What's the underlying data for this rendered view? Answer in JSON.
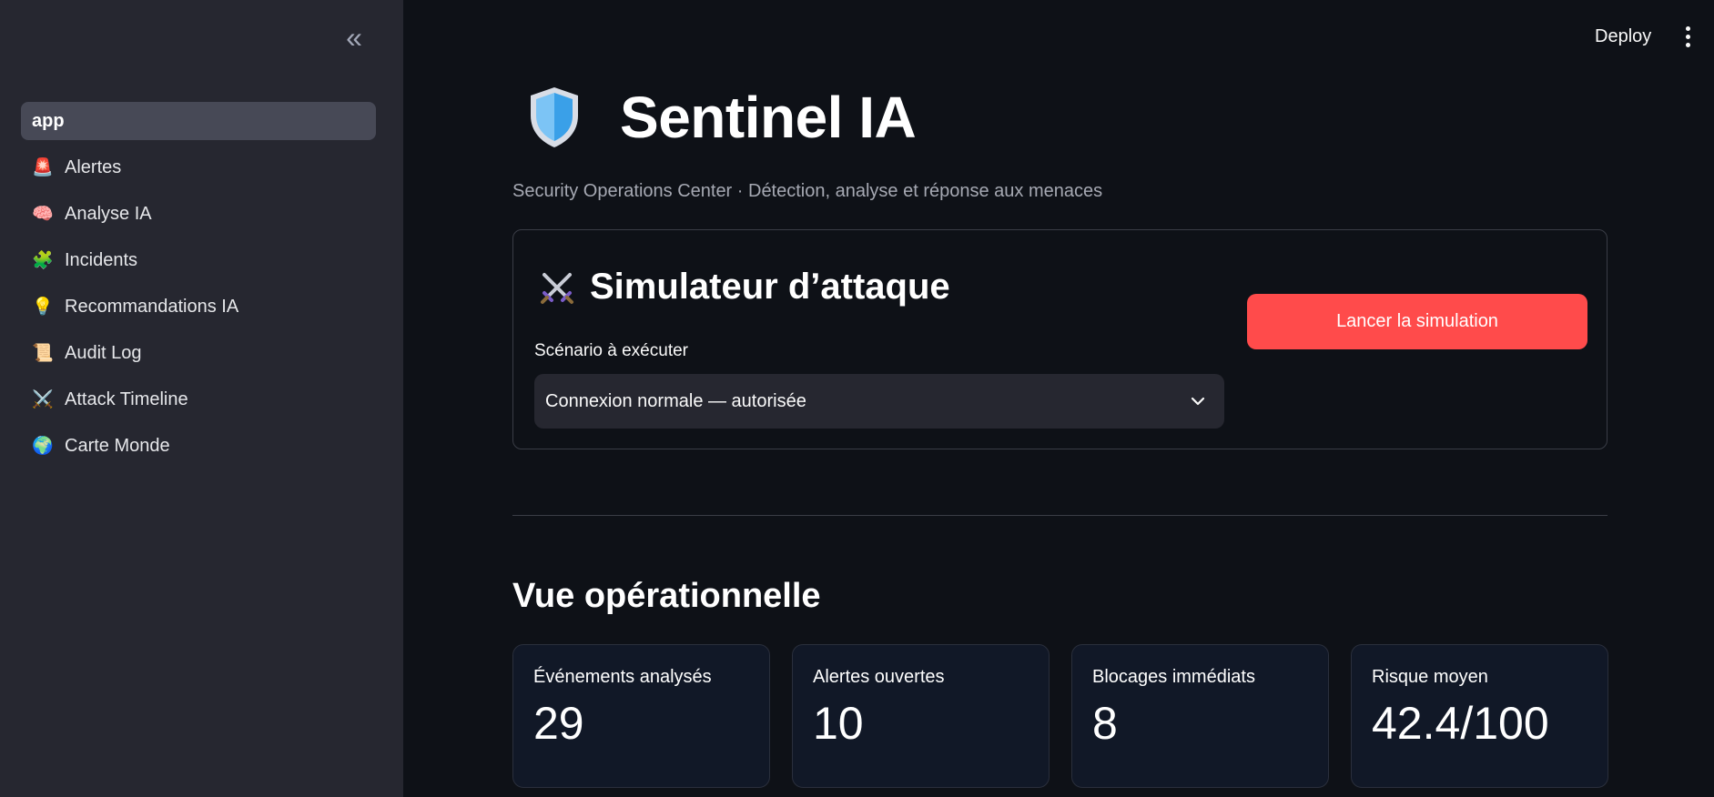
{
  "sidebar": {
    "collapse_glyph": "«",
    "items": [
      {
        "label": "app",
        "icon": "",
        "active": true
      },
      {
        "label": "Alertes",
        "icon": "🚨"
      },
      {
        "label": "Analyse IA",
        "icon": "🧠"
      },
      {
        "label": "Incidents",
        "icon": "🧩"
      },
      {
        "label": "Recommandations IA",
        "icon": "💡"
      },
      {
        "label": "Audit Log",
        "icon": "📜"
      },
      {
        "label": "Attack Timeline",
        "icon": "⚔️"
      },
      {
        "label": "Carte Monde",
        "icon": "🌍"
      }
    ]
  },
  "header": {
    "deploy_label": "Deploy",
    "menu_icon": "kebab-menu-icon"
  },
  "main": {
    "title": "Sentinel IA",
    "title_icon": "shield-icon",
    "subtitle": "Security Operations Center · Détection, analyse et réponse aux menaces",
    "simulator": {
      "title": "Simulateur d’attaque",
      "title_icon": "crossed-swords-icon",
      "scenario_label": "Scénario à exécuter",
      "scenario_value": "Connexion normale — autorisée",
      "run_button": "Lancer la simulation"
    },
    "overview": {
      "title": "Vue opérationnelle",
      "metrics": [
        {
          "label": "Événements analysés",
          "value": "29"
        },
        {
          "label": "Alertes ouvertes",
          "value": "10"
        },
        {
          "label": "Blocages immédiats",
          "value": "8"
        },
        {
          "label": "Risque moyen",
          "value": "42.4/100"
        }
      ]
    }
  },
  "colors": {
    "background": "#0e1117",
    "sidebar": "#262730",
    "accent": "#ff4b4b",
    "card": "#111827"
  }
}
